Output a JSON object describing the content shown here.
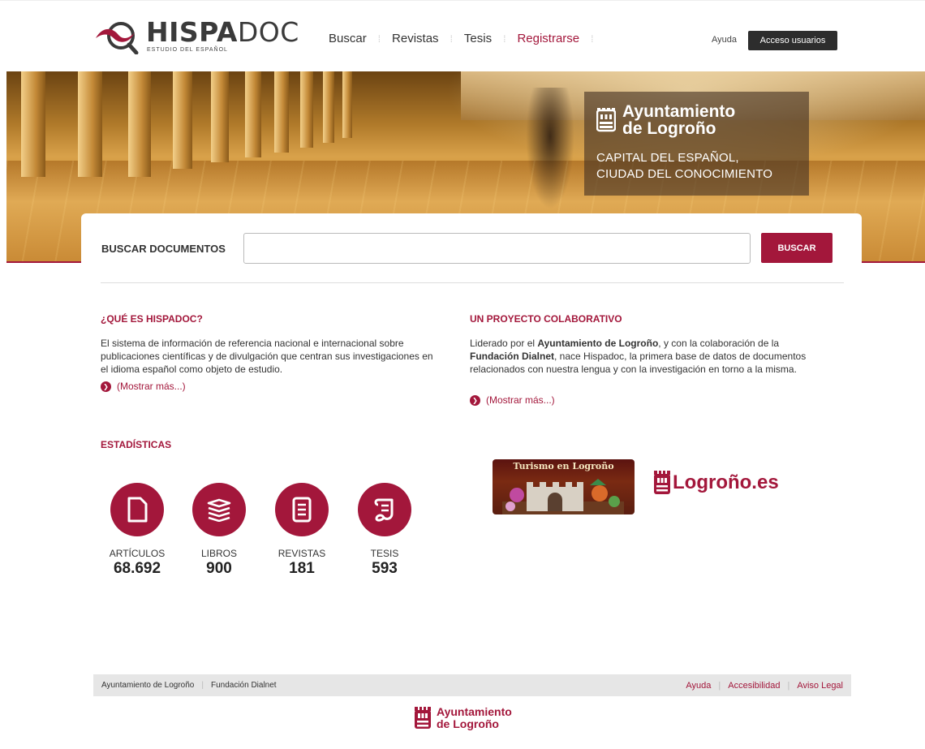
{
  "header": {
    "logo_bold": "HISPA",
    "logo_light": "DOC",
    "logo_tagline": "ESTUDIO DEL ESPAÑOL",
    "nav": [
      {
        "label": "Buscar"
      },
      {
        "label": "Revistas"
      },
      {
        "label": "Tesis"
      },
      {
        "label": "Registrarse"
      }
    ],
    "help_label": "Ayuda",
    "access_label": "Acceso usuarios"
  },
  "hero": {
    "org_line1": "Ayuntamiento",
    "org_line2": "de Logroño",
    "sub_line1": "CAPITAL DEL ESPAÑOL,",
    "sub_line2": "CIUDAD DEL CONOCIMIENTO"
  },
  "search": {
    "label": "BUSCAR DOCUMENTOS",
    "placeholder": "",
    "button_label": "BUSCAR"
  },
  "about": {
    "title": "¿QUÉ ES HISPADOC?",
    "text": "El sistema de información de referencia nacional e internacional sobre publicaciones científicas y de divulgación que centran sus investigaciones en el idioma español como objeto de estudio.",
    "more": "(Mostrar más...)"
  },
  "project": {
    "title": "UN PROYECTO COLABORATIVO",
    "text_a": "Liderado por el ",
    "text_b": "Ayuntamiento de Logroño",
    "text_c": ", y con la colaboración de la ",
    "text_d": "Fundación Dialnet",
    "text_e": ", nace Hispadoc, la primera base de datos de documentos relacionados con nuestra lengua y con la investigación en torno a la misma.",
    "more": "(Mostrar más...)"
  },
  "stats": {
    "title": "ESTADÍSTICAS",
    "items": [
      {
        "label": "ARTÍCULOS",
        "value": "68.692",
        "icon": "document-icon"
      },
      {
        "label": "LIBROS",
        "value": "900",
        "icon": "books-icon"
      },
      {
        "label": "REVISTAS",
        "value": "181",
        "icon": "journal-icon"
      },
      {
        "label": "TESIS",
        "value": "593",
        "icon": "scroll-icon"
      }
    ]
  },
  "promo": {
    "turismo_label": "Turismo en Logroño",
    "logrono_es": "Logroño.es"
  },
  "footer": {
    "left": [
      "Ayuntamiento de Logroño",
      "Fundación Dialnet"
    ],
    "right": [
      "Ayuda",
      "Accesibilidad",
      "Aviso Legal"
    ],
    "logo_line1": "Ayuntamiento",
    "logo_line2": "de Logroño"
  },
  "colors": {
    "accent": "#a3173b",
    "dark": "#2d2d2d"
  }
}
